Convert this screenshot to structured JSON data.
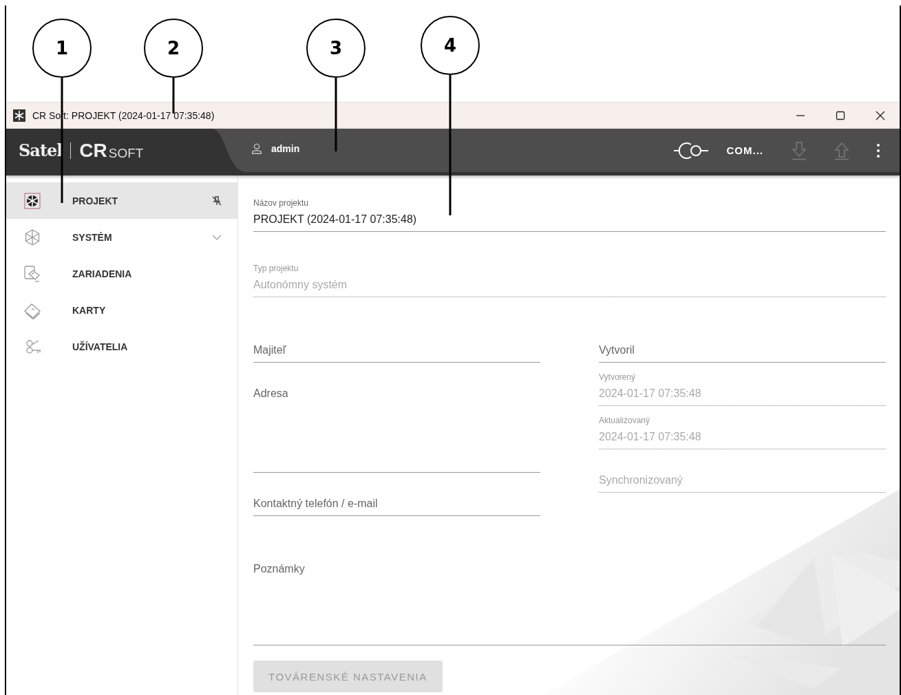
{
  "callouts": [
    "1",
    "2",
    "3",
    "4"
  ],
  "window": {
    "title": "CR Soft: PROJEKT (2024-01-17 07:35:48)"
  },
  "header": {
    "logo": {
      "brand": "Satel",
      "product": "CR",
      "suffix": "SOFT"
    },
    "user": "admin",
    "connection": "COM...",
    "actions": [
      {
        "kind": "download",
        "disabled": true
      },
      {
        "kind": "upload",
        "disabled": true
      }
    ]
  },
  "sidebar": {
    "items": [
      {
        "label": "PROJEKT",
        "kind": "project",
        "selected": true,
        "pinned": true
      },
      {
        "label": "SYSTÉM",
        "kind": "system",
        "selected": false,
        "expanded": false
      },
      {
        "label": "ZARIADENIA",
        "kind": "devices",
        "selected": false
      },
      {
        "label": "KARTY",
        "kind": "cards",
        "selected": false
      },
      {
        "label": "UŽÍVATELIA",
        "kind": "users",
        "selected": false
      }
    ]
  },
  "form": {
    "fields": [
      {
        "kind": "text",
        "label": "Názov projektu",
        "value": "PROJEKT (2024-01-17 07:35:48)"
      },
      {
        "kind": "readonly",
        "label": "Typ projektu",
        "value": "Autonómny systém"
      }
    ],
    "left": [
      {
        "kind": "text",
        "placeholder": "Majiteľ"
      },
      {
        "kind": "textarea",
        "placeholder": "Adresa"
      },
      {
        "kind": "text",
        "placeholder": "Kontaktný telefón / e-mail"
      }
    ],
    "right": [
      {
        "kind": "text",
        "placeholder": "Vytvoril"
      },
      {
        "kind": "readonly",
        "label": "Vytvorený",
        "value": "2024-01-17 07:35:48"
      },
      {
        "kind": "readonly",
        "label": "Aktualizovaný",
        "value": "2024-01-17 07:35:48"
      },
      {
        "kind": "readonly",
        "placeholder": "Synchronizovaný"
      }
    ],
    "notes": {
      "kind": "textarea",
      "placeholder": "Poznámky"
    },
    "reset_button": {
      "label": "TOVÁRENSKÉ NASTAVENIA",
      "disabled": true
    }
  }
}
